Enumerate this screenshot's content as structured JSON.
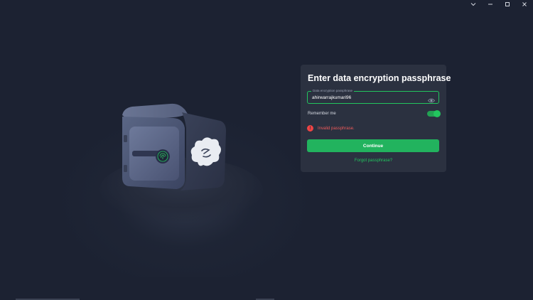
{
  "window": {
    "controls": [
      "chevron-down",
      "minimize",
      "maximize",
      "close"
    ]
  },
  "card": {
    "title": "Enter data encryption passphrase",
    "field_label": "Data encryption passphrase",
    "field_value": "ahirwarrajkumari96",
    "remember_label": "Remember me",
    "remember_on": true,
    "error_text": "Invalid passphrase.",
    "error_icon": "!",
    "continue_label": "Continue",
    "forgot_label": "Forgot passphrase?"
  },
  "colors": {
    "background": "#1c2232",
    "card": "#2b3140",
    "accent": "#22c55e",
    "error": "#ef4444"
  }
}
